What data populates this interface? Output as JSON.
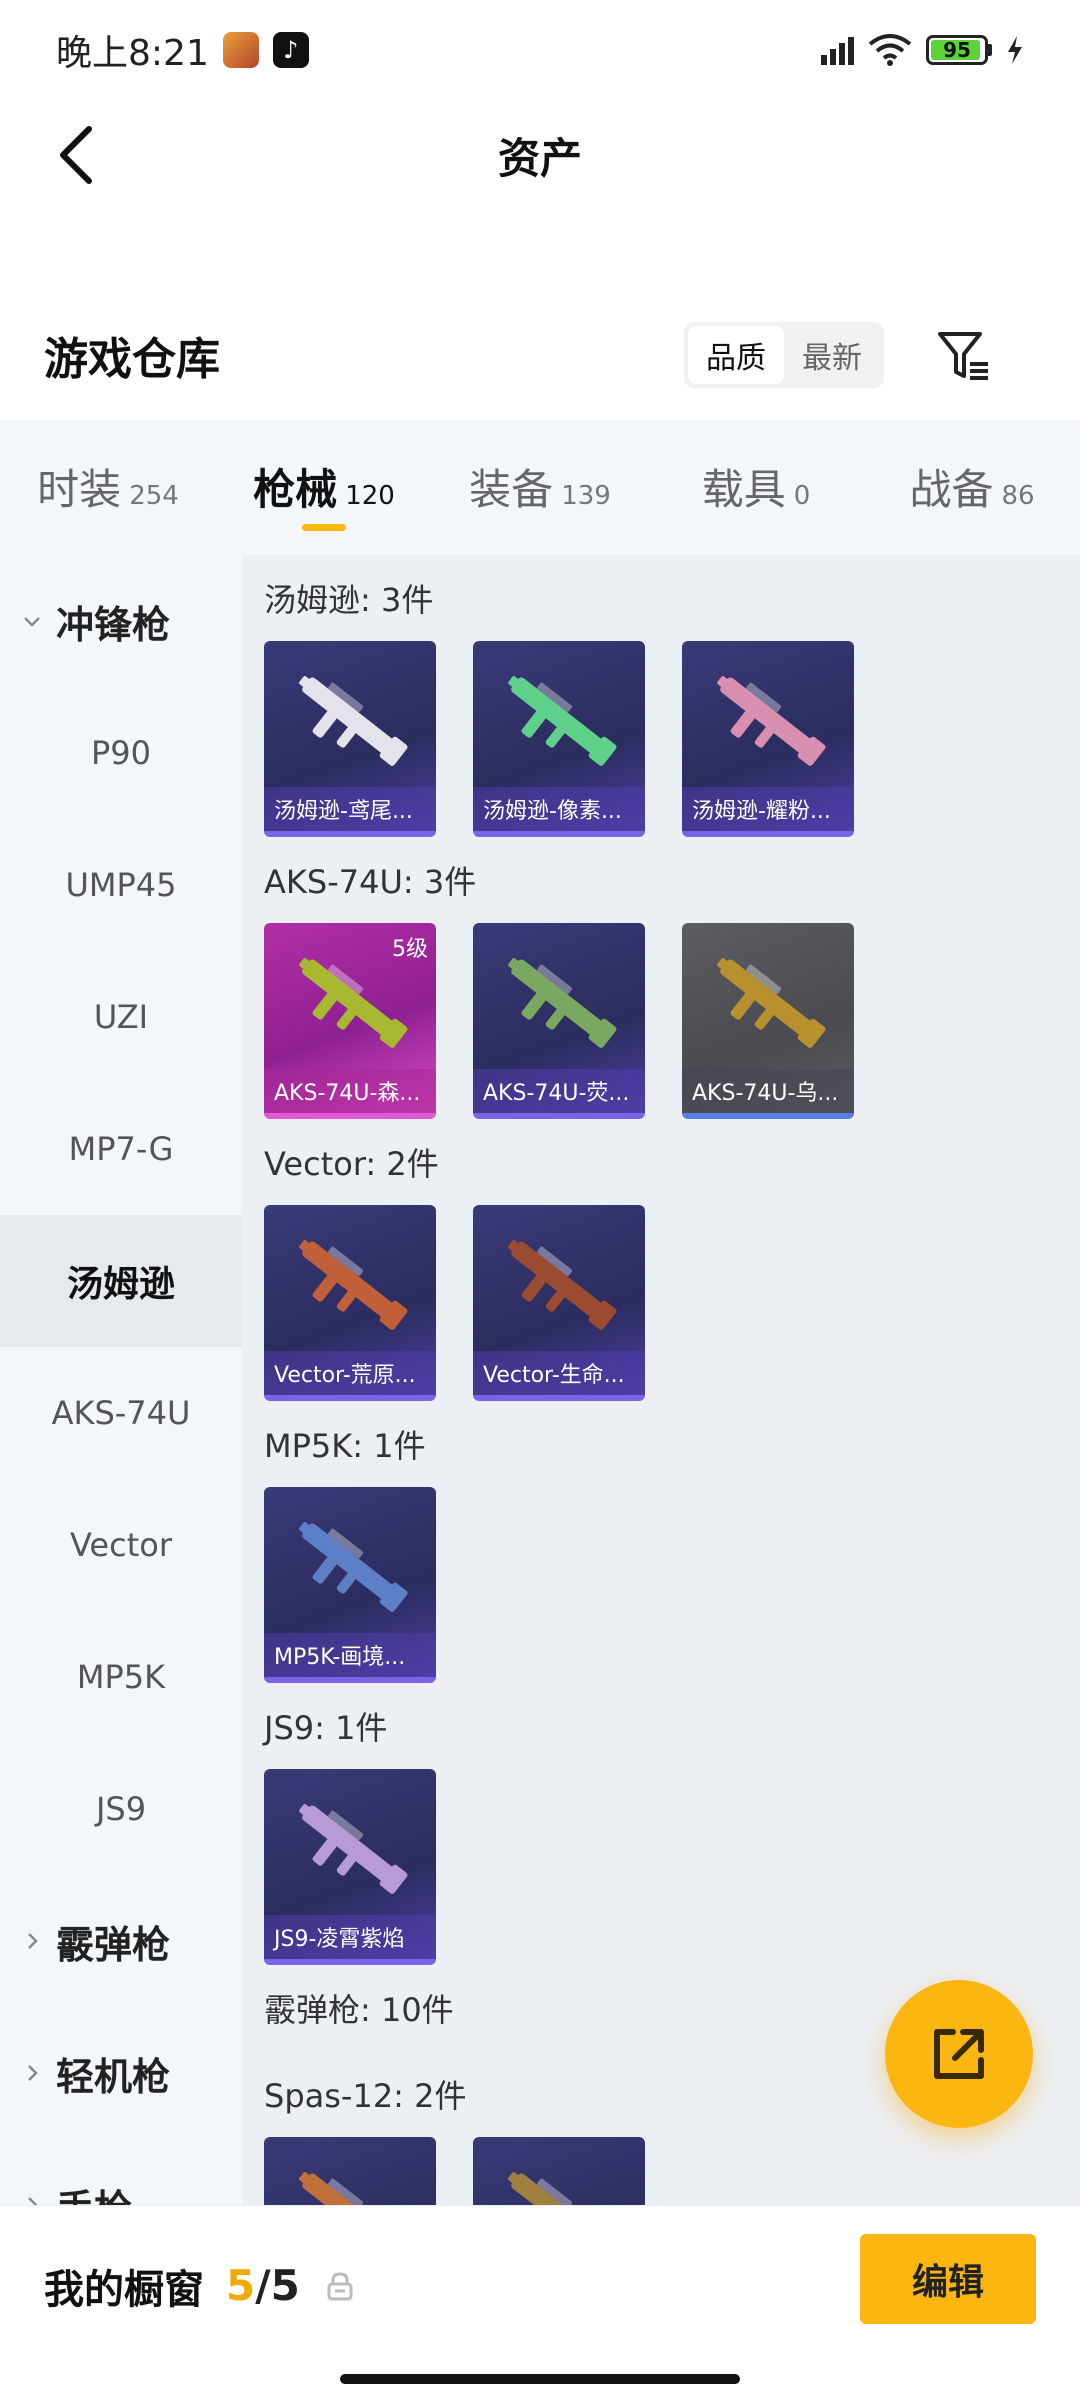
{
  "status_bar": {
    "time": "晚上8:21",
    "battery": "95"
  },
  "header": {
    "title": "资产"
  },
  "warehouse": {
    "title": "游戏仓库",
    "sort_options": [
      "品质",
      "最新"
    ],
    "sort_selected": "品质"
  },
  "tabs": [
    {
      "label": "时装",
      "count": "254"
    },
    {
      "label": "枪械",
      "count": "120"
    },
    {
      "label": "装备",
      "count": "139"
    },
    {
      "label": "载具",
      "count": "0"
    },
    {
      "label": "战备",
      "count": "86"
    }
  ],
  "active_tab": "枪械",
  "sidebar": {
    "items": [
      {
        "label": "冲锋枪",
        "type": "group"
      },
      {
        "label": "P90",
        "type": "sub"
      },
      {
        "label": "UMP45",
        "type": "sub"
      },
      {
        "label": "UZI",
        "type": "sub"
      },
      {
        "label": "MP7-G",
        "type": "sub"
      },
      {
        "label": "汤姆逊",
        "type": "sub"
      },
      {
        "label": "AKS-74U",
        "type": "sub"
      },
      {
        "label": "Vector",
        "type": "sub"
      },
      {
        "label": "MP5K",
        "type": "sub"
      },
      {
        "label": "JS9",
        "type": "sub"
      },
      {
        "label": "霰弹枪",
        "type": "group"
      },
      {
        "label": "轻机枪",
        "type": "group"
      },
      {
        "label": "手枪",
        "type": "group"
      }
    ],
    "active": "汤姆逊"
  },
  "content": {
    "groups": [
      {
        "header": "汤姆逊: 3件",
        "items": [
          {
            "label": "汤姆逊-鸢尾...",
            "style": "purple",
            "color": "#e6e2ec"
          },
          {
            "label": "汤姆逊-像素...",
            "style": "purple",
            "color": "#5fd08a"
          },
          {
            "label": "汤姆逊-耀粉...",
            "style": "purple",
            "color": "#d98fb0"
          }
        ]
      },
      {
        "header": "AKS-74U: 3件",
        "items": [
          {
            "label": "AKS-74U-森...",
            "style": "gold",
            "color": "#a8b830",
            "badge": "5级"
          },
          {
            "label": "AKS-74U-荧...",
            "style": "purple",
            "color": "#7aa860"
          },
          {
            "label": "AKS-74U-乌...",
            "style": "grey",
            "color": "#b8902e"
          }
        ]
      },
      {
        "header": "Vector: 2件",
        "items": [
          {
            "label": "Vector-荒原...",
            "style": "purple",
            "color": "#c0603a"
          },
          {
            "label": "Vector-生命...",
            "style": "purple",
            "color": "#9a4b32"
          }
        ]
      },
      {
        "header": "MP5K: 1件",
        "items": [
          {
            "label": "MP5K-画境...",
            "style": "purple",
            "color": "#5d7fc8"
          }
        ]
      },
      {
        "header": "JS9: 1件",
        "items": [
          {
            "label": "JS9-凌霄紫焰",
            "style": "purple",
            "color": "#b79ad6"
          }
        ]
      },
      {
        "header": "霰弹枪: 10件",
        "items": []
      },
      {
        "header": "Spas-12: 2件",
        "items": [
          {
            "label": "",
            "style": "purple",
            "color": "#c0703a"
          },
          {
            "label": "",
            "style": "purple",
            "color": "#a08040"
          }
        ]
      }
    ]
  },
  "bottom_bar": {
    "title": "我的橱窗",
    "count_current": "5",
    "count_total": "/5",
    "edit_label": "编辑"
  },
  "colors": {
    "accent": "#fbb612",
    "count_highlight": "#f2a900",
    "tab_underline": "#f7b90f"
  }
}
